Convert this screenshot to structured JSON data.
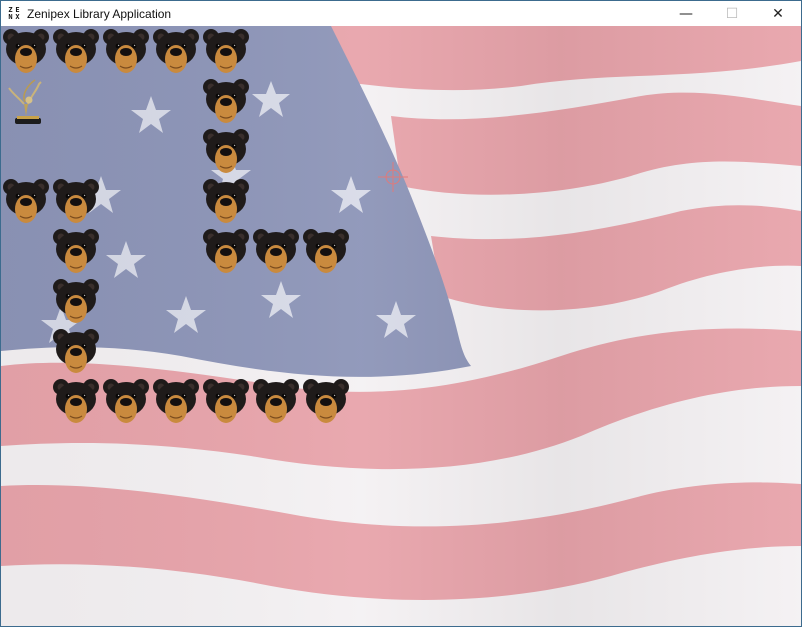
{
  "window": {
    "title": "Zenipex Library Application",
    "icon_name": "zenipex-app-icon",
    "icon_glyphs": [
      "Z",
      "E",
      "N",
      "X"
    ],
    "controls": {
      "minimize": "—",
      "maximize": "☐",
      "close": "✕"
    }
  },
  "game": {
    "background": "american-flag",
    "colors": {
      "bear_fur": "#1f1b1a",
      "bear_muzzle": "#c98a3e",
      "flag_red": "#e8a4ab",
      "flag_blue": "#8d95b8"
    },
    "bears": [
      {
        "col": 0,
        "row": 0
      },
      {
        "col": 1,
        "row": 0
      },
      {
        "col": 2,
        "row": 0
      },
      {
        "col": 3,
        "row": 0
      },
      {
        "col": 4,
        "row": 0
      },
      {
        "col": 4,
        "row": 1
      },
      {
        "col": 4,
        "row": 2
      },
      {
        "col": 0,
        "row": 3
      },
      {
        "col": 1,
        "row": 3
      },
      {
        "col": 4,
        "row": 3
      },
      {
        "col": 1,
        "row": 4
      },
      {
        "col": 4,
        "row": 4
      },
      {
        "col": 5,
        "row": 4
      },
      {
        "col": 6,
        "row": 4
      },
      {
        "col": 1,
        "row": 5
      },
      {
        "col": 1,
        "row": 6
      },
      {
        "col": 1,
        "row": 7
      },
      {
        "col": 2,
        "row": 7
      },
      {
        "col": 3,
        "row": 7
      },
      {
        "col": 4,
        "row": 7
      },
      {
        "col": 5,
        "row": 7
      },
      {
        "col": 6,
        "row": 7
      }
    ],
    "trophy": {
      "col": 0,
      "row": 1,
      "name": "trophy-statue"
    }
  }
}
